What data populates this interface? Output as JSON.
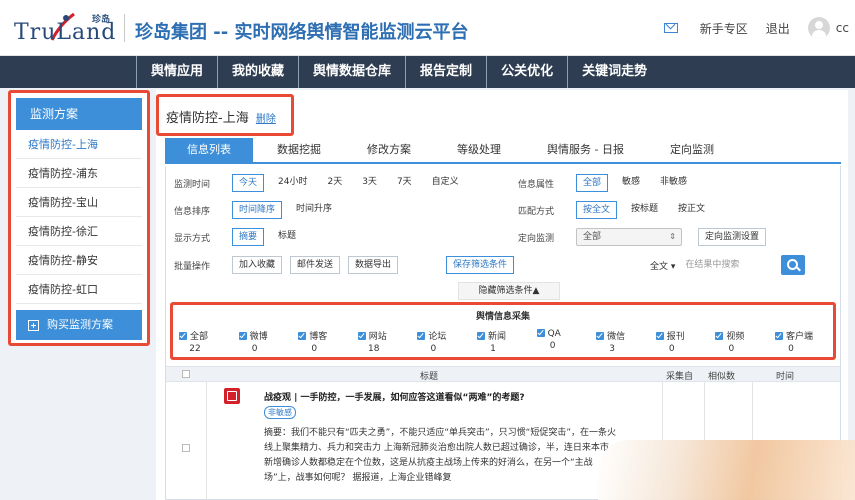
{
  "header": {
    "logo_text": "TruLand",
    "logo_cn": "珍岛",
    "title": "珍岛集团 -- 实时网络舆情智能监测云平台",
    "links": [
      "新手专区",
      "退出"
    ],
    "user": "cc"
  },
  "nav": [
    "舆情应用",
    "我的收藏",
    "舆情数据仓库",
    "报告定制",
    "公关优化",
    "关键词走势"
  ],
  "sidebar": {
    "title": "监测方案",
    "items": [
      "疫情防控-上海",
      "疫情防控-浦东",
      "疫情防控-宝山",
      "疫情防控-徐汇",
      "疫情防控-静安",
      "疫情防控-虹口"
    ],
    "buy": "购买监测方案"
  },
  "plan": {
    "title": "疫情防控-上海",
    "delete": "删除"
  },
  "tabs": [
    "信息列表",
    "数据挖掘",
    "修改方案",
    "等级处理",
    "舆情服务 - 日报",
    "定向监测"
  ],
  "filters": {
    "time": {
      "label": "监测时间",
      "options": [
        "今天",
        "24小时",
        "2天",
        "3天",
        "7天",
        "自定义"
      ]
    },
    "attr": {
      "label": "信息属性",
      "options": [
        "全部",
        "敏感",
        "非敏感"
      ]
    },
    "sort": {
      "label": "信息排序",
      "options": [
        "时间降序",
        "时间升序"
      ]
    },
    "match": {
      "label": "匹配方式",
      "options": [
        "按全文",
        "按标题",
        "按正文"
      ]
    },
    "display": {
      "label": "显示方式",
      "options": [
        "摘要",
        "标题"
      ]
    },
    "directed": {
      "label": "定向监测",
      "select": "全部",
      "button": "定向监测设置"
    },
    "batch": {
      "label": "批量操作",
      "options": [
        "加入收藏",
        "邮件发送",
        "数据导出"
      ]
    },
    "save": "保存筛选条件",
    "search_mode": "全文",
    "search_placeholder": "在结果中搜索",
    "hide": "隐藏筛选条件▲"
  },
  "sources": {
    "title": "舆情信息采集",
    "items": [
      {
        "label": "全部",
        "count": "22"
      },
      {
        "label": "微博",
        "count": "0"
      },
      {
        "label": "博客",
        "count": "0"
      },
      {
        "label": "网站",
        "count": "18"
      },
      {
        "label": "论坛",
        "count": "0"
      },
      {
        "label": "新闻",
        "count": "1"
      },
      {
        "label": "QA",
        "count": "0"
      },
      {
        "label": "微信",
        "count": "3"
      },
      {
        "label": "报刊",
        "count": "0"
      },
      {
        "label": "视频",
        "count": "0"
      },
      {
        "label": "客户端",
        "count": "0"
      }
    ]
  },
  "table": {
    "headers": [
      "标题",
      "采集自",
      "相似数",
      "时间"
    ],
    "rows": [
      {
        "title": "战疫观 | 一手防控，一手发展，如何应答这道看似“两难”的考题?",
        "badge": "非敏感",
        "summary": "摘要：我们不能只有“匹夫之勇”，不能只适应“单兵突击”，只习惯“短促突击”，在一条火线上聚集精力、兵力和突击力 上海新冠肺炎治愈出院人数已超过确诊，半，连日来本市新增确诊人数都稳定在个位数，这是从抗疫主战场上传来的好消么，在另一个“主战场”上，战事如何呢？ 据报道，上海企业错峰复"
      }
    ]
  },
  "colors": {
    "accent": "#3d8fd9",
    "nav_bg": "#2e3d51",
    "highlight": "#e94a35"
  }
}
